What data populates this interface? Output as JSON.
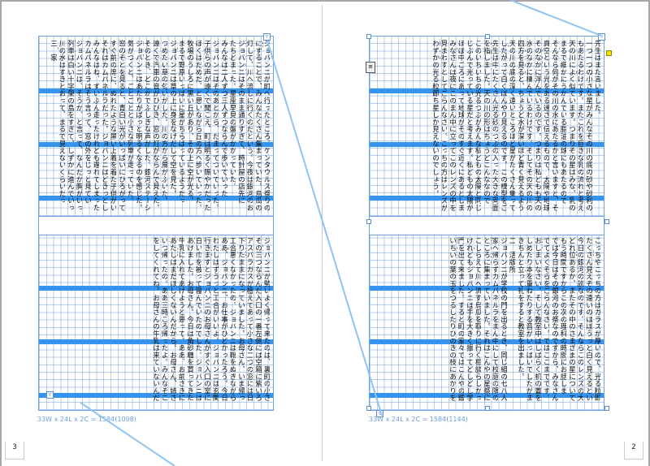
{
  "pages": {
    "left_number": "3",
    "right_number": "2"
  },
  "frames": {
    "left_info": "33W x 24L x 2C = 1584(1098)",
    "right_info": "33W x 24L x 2C = 1584(1144)",
    "inport_symbol": "▿",
    "outport_symbol": "▿"
  },
  "text": {
    "left_top_cols": [
      "ジョバンニが町へ行ったところ、ケンタウルス祭りの晩",
      "にすることで、みんなたくさん集まっていた。烏瓜のあかりを",
      "灯して、川へ流しに行くのだという。今夜は銀河のお祭りなのだ",
      "ジョバンニはそのまま通りすぎて、時計屋の店先に",
      "たちどまった。星座早見の盤がかかっていた。",
      "みんなは二人ずつ三人ずつならんで歩いていった",
      "ジョバンニはそのあとから、だまってついていった。",
      "子供らの声が遠くで聞こえ、町は明るく賑やかだった",
      "ぼくはだめだ、と思いながら丘の方へ歩いていった。",
      "牧場のうしろに黒い丘があり、その上に空が光る。",
      "まるで野原いっぱいに星がちらばっているようだった。",
      "ジョバンニは草の上に身をなげだして空を見た。",
      "つめたい草の匂いがした。川の方から風がふいた。",
      "遠くで汽車の音がひびき、窓の灯がならんで見えた。",
      "そのとき、どこかでふしぎな声がした。銀河ステーション。",
      "ジョバンニはあたりがぱっと明るくなるのを感じた。",
      "気がつくと、ごとごとと小さな列車が走っていた。",
      "窓のそとを見ると、青白い光がいっぱいにひろがっていた。",
      "すぐ前の席に、ぬれたような黒い上着を着た子供がいた。",
      "それはカムパネルラだった。ジョバンニはどきっとした。",
      "みんなはね、ずいぶん走ったけれども遅れてしまったよ。",
      "カムパネルラはそう言って、窓の外をじっと見ていた。",
      "ジョバンニは、そうか、と言って、なんだか胸がいっぱいだった",
      "列車は白い十字架の島をすぎて、しずかに進んでいった。",
      "川の水はすきとおって、まるで見えないくらいだった。",
      "三　家"
    ],
    "left_bottom_cols": [
      "ジョバンニが勢いよく帰って来たのは、裏町の小さな家でした。",
      "その三つならんだ入口の一番左側には空箱に紫いろのケールや",
      "アスパラガスが植えてあって小さな二つの窓には日覆いが",
      "下りたままになっていました。お母さん、いま帰ったよ。",
      "工合悪くなかったの。ジョバンニは靴をぬぎながら言いました",
      "ああ、ジョバンニ、お仕事がひどかったろう。今日は涼しくてね",
      "わたしはずうっと工合がいいよ。ジョバンニは玄関を上って",
      "行きますとジョバンニのお母さんがすぐ入口の室に",
      "白い巾を被って寝んでいたのでした。ジョバンニは窓を",
      "あけました。お母さん。今日は角砂糖を買ってきたよ。",
      "牛乳に入れてあげようと思って。ああ、お前さきにおあがり。",
      "あたしはまだほしくないんだから。お母さん、姉さんは",
      "いつ帰ったの。ああ三時ころ帰ったよ。みんなそこら",
      "をしてくれてね。お母さんの牛乳は来ていないんだろうか"
    ],
    "right_top_cols": [
      "先生はまた言いました。",
      "一つ一つの小さな星がみんなその川の底の砂や砂利の粒に",
      "もあたるわけです。またこれを巨きな乳の流れと考えるならもっと",
      "天の川によく似ています。つまりその星はみな、乳のなかに",
      "まるで細かにうかんでいる脂油の球にもあたるのです。",
      "そんなら何がその川の水にあたるかと言いますと、それは",
      "真空という光をある速さで伝えるもので、太陽や地球もやっぱり",
      "そのなかに浮んでいるのです。つまりは私どもも天の川の",
      "水のなかに棲んでいるわけです。そしてその天の川の水のなかから",
      "四方を見ると、ちょうど水が深いほど青く見えるように",
      "天の川の底の深く遠いところほど星がたくさん集って見え",
      "したがって白くぼんやり見えるのです。この模型をごらんなさい。",
      "先生は中にたくさん光る砂のつぶの入った大きな両面の凸レンズ",
      "を指しました。天の川の形はちょうどこんななのです。",
      "このいちいちの光るつぶがみんな私どもの太陽と同じように",
      "じぶんで光っている星だと考えます。私どもの太陽がこの",
      "ほぼ中ごろにあって地球がそのすぐ近くにあるとします。",
      "みなさんは夜にこのまん中に立ってこのレンズの中を",
      "見まわすとしてごらんなさい。こっちの方はレンズが薄いので",
      "わずかの光る粒即ち星しか見えないのでしょう。"
    ],
    "right_bottom_cols": [
      "こっちやこっちの方はガラスが厚いので、光る粒即ち星が",
      "たくさん見えその遠いのはぼうっと白く見えるという、これがつまり",
      "今日の銀河の説なのです。そんならこのレンズの大きさが",
      "どれ位あるか、またその中のさまざまの星については",
      "もう時間ですからこの次の理科の時間にお話します。",
      "では今日はその銀河のお祭なのですから、みなさんは外へ",
      "でてよくそらをごらんなさい。ではここまでです。本やノートを",
      "おしまいなさい。そして教室中はしばらく机の蓋をあけたり",
      "しめたり本を重ねたりする音がいっぱいでしたがまもなくみんなは",
      "きちんと立って礼をすると教室を出ました。",
      "二　活版所",
      "ジョバンニが学校の門を出るとき、同じ組の七八人は",
      "家へ帰らずカムパネルラをまん中にして校庭の隅の桜の木の",
      "ところに集まっていました。それはこんやの星祭に青いあかりを",
      "こしらえて川へ流す烏瓜を取りに行く相談らしかったのです。",
      "けれどもジョバンニは手を大きく振ってどしどし学校の",
      "門を出て来ました。すると町の家々ではこんやの銀河の祭りに",
      "いちいの葉の玉をつるしたりひのきの枝にあかりをつけたり"
    ]
  },
  "colors": {
    "band": "#3794ee",
    "grid": "#78aae6",
    "thread": "#8fc3f2",
    "pasteboard": "#a9a5a8"
  }
}
